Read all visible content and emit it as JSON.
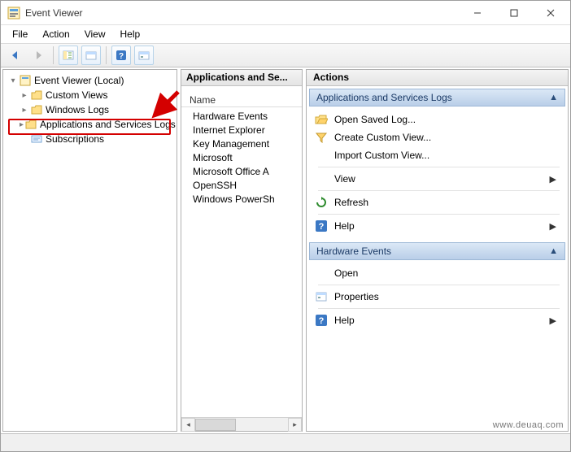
{
  "window": {
    "title": "Event Viewer"
  },
  "menu": {
    "file": "File",
    "action": "Action",
    "view": "View",
    "help": "Help"
  },
  "tree": {
    "root": "Event Viewer (Local)",
    "items": [
      "Custom Views",
      "Windows Logs",
      "Applications and Services Logs",
      "Subscriptions"
    ]
  },
  "mid": {
    "header": "Applications and Se...",
    "col": "Name",
    "rows": [
      "Hardware Events",
      "Internet Explorer",
      "Key Management",
      "Microsoft",
      "Microsoft Office A",
      "OpenSSH",
      "Windows PowerSh"
    ]
  },
  "right": {
    "title": "Actions",
    "group1": "Applications and Services Logs",
    "group2": "Hardware Events",
    "a1": "Open Saved Log...",
    "a2": "Create Custom View...",
    "a3": "Import Custom View...",
    "a4": "View",
    "a5": "Refresh",
    "a6": "Help",
    "b1": "Open",
    "b2": "Properties",
    "b3": "Help"
  },
  "watermark": "www.deuaq.com"
}
